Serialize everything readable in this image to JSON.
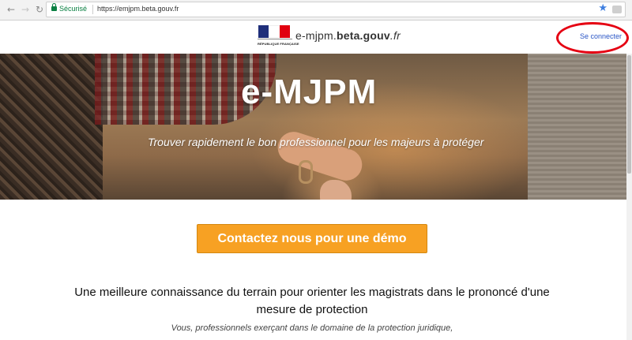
{
  "browser": {
    "secure_label": "Sécurisé",
    "url": "https://emjpm.beta.gouv.fr"
  },
  "header": {
    "logo_text": "RÉPUBLIQUE FRANÇAISE",
    "brand_prefix": "e-mjpm.",
    "brand_middle": "beta.gouv",
    "brand_suffix": ".fr",
    "login_label": "Se connecter"
  },
  "hero": {
    "title": "e-MJPM",
    "tagline": "Trouver rapidement le bon professionnel pour les majeurs à protéger"
  },
  "main": {
    "cta_label": "Contactez nous pour une démo",
    "headline": "Une meilleure connaissance du terrain pour orienter les magistrats dans le prononcé d'une mesure de protection",
    "subtext": "Vous, professionnels exerçant dans le domaine de la protection juridique,"
  },
  "colors": {
    "accent": "#f7a123",
    "link": "#2a56c6",
    "annotation": "#e50012"
  }
}
